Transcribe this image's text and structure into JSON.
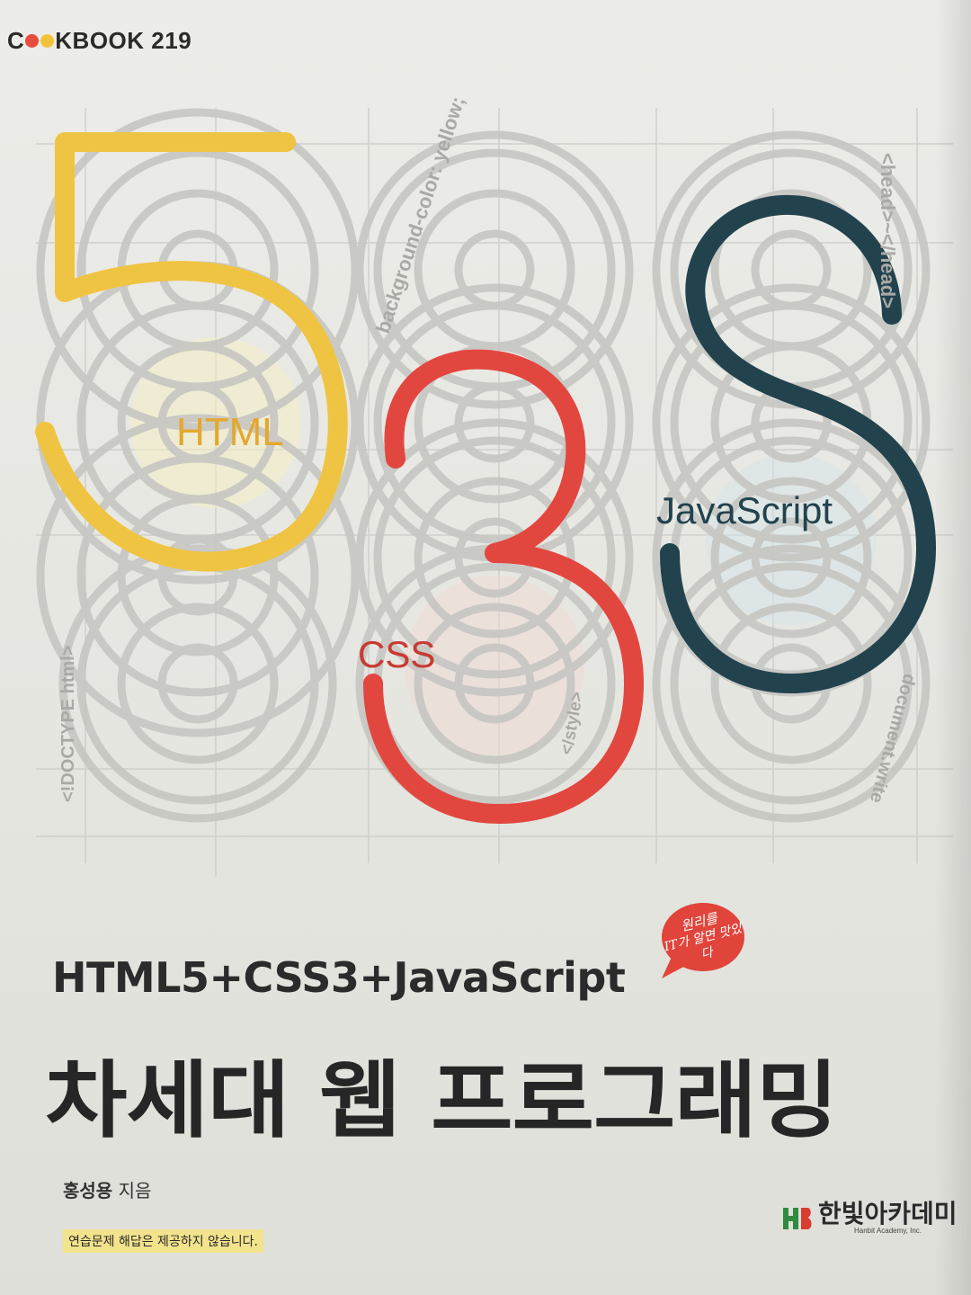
{
  "cover": {
    "series": {
      "prefix": "C",
      "suffix": "KBOOK 219",
      "dot_colors": [
        "#e84c3d",
        "#f2c23a"
      ]
    },
    "art": {
      "digits": [
        "5",
        "3",
        "S"
      ],
      "labels": {
        "html": "HTML",
        "css": "CSS",
        "javascript": "JavaScript"
      },
      "code_snippets": {
        "background": "background-color: yellow;",
        "head": "<head>~</head>",
        "doctype": "<!DOCTYPE html>",
        "style": "</style>",
        "document": "document.write"
      },
      "colors": {
        "html": "#f0c443",
        "css": "#e2473f",
        "javascript": "#22434e",
        "rings": "#c4c4c0"
      }
    },
    "badge": {
      "line1": "원리를",
      "line2": "IT가 알면 맛있다",
      "color": "#e0443a"
    },
    "subtitle": "HTML5+CSS3+JavaScript",
    "title": "차세대 웹 프로그래밍",
    "author": {
      "name": "홍성용",
      "role": "지음"
    },
    "notice": "연습문제 해답은 제공하지 않습니다.",
    "publisher": {
      "name": "한빛아카데미",
      "name_en": "Hanbit Academy, Inc."
    }
  }
}
